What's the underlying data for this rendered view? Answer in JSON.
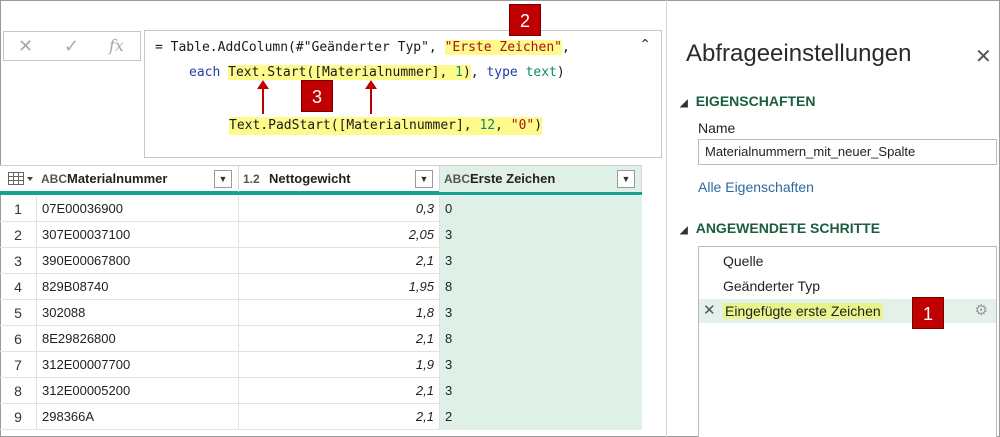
{
  "formula_bar": {
    "cancel_icon": "x-icon",
    "commit_icon": "check-icon",
    "fx_label": "fx",
    "line1_pre": "= Table.AddColumn(#\"Geänderter Typ\", ",
    "line1_hl": "\"Erste Zeichen\"",
    "line1_post": ",",
    "line2_kw": "each",
    "line2_func": "Text.Start([Materialnummer], ",
    "line2_num": "1",
    "line2_close": ")",
    "line2_rest": ", ",
    "line2_type": "type",
    "line2_text": "text",
    "line2_end": ")",
    "line3_pre": "Text.PadStart([Materialnummer], ",
    "line3_num": "12",
    "line3_mid": ", ",
    "line3_str": "\"0\"",
    "line3_end": ")",
    "collapse_icon": "chevron-up-icon"
  },
  "badges": {
    "b1": "1",
    "b2": "2",
    "b3": "3"
  },
  "accent_colors": {
    "badge": "#c00000",
    "header_underline": "#13a38f",
    "selected_column": "#dff0e7",
    "highlight": "#fffa8c"
  },
  "table": {
    "columns": [
      {
        "type": "ABC",
        "label": "Materialnummer"
      },
      {
        "type": "1.2",
        "label": "Nettogewicht"
      },
      {
        "type": "ABC",
        "label": "Erste Zeichen"
      }
    ],
    "rows": [
      {
        "idx": "1",
        "mat": "07E00036900",
        "net": "0,3",
        "ez": "0"
      },
      {
        "idx": "2",
        "mat": "307E00037100",
        "net": "2,05",
        "ez": "3"
      },
      {
        "idx": "3",
        "mat": "390E00067800",
        "net": "2,1",
        "ez": "3"
      },
      {
        "idx": "4",
        "mat": "829B08740",
        "net": "1,95",
        "ez": "8"
      },
      {
        "idx": "5",
        "mat": "302088",
        "net": "1,8",
        "ez": "3"
      },
      {
        "idx": "6",
        "mat": "8E29826800",
        "net": "2,1",
        "ez": "8"
      },
      {
        "idx": "7",
        "mat": "312E00007700",
        "net": "1,9",
        "ez": "3"
      },
      {
        "idx": "8",
        "mat": "312E00005200",
        "net": "2,1",
        "ez": "3"
      },
      {
        "idx": "9",
        "mat": "298366A",
        "net": "2,1",
        "ez": "2"
      }
    ]
  },
  "pane": {
    "title": "Abfrageeinstellungen",
    "close_icon": "close-icon",
    "properties_heading": "EIGENSCHAFTEN",
    "name_label": "Name",
    "name_value": "Materialnummern_mit_neuer_Spalte",
    "all_properties_link": "Alle Eigenschaften",
    "steps_heading": "ANGEWENDETE SCHRITTE",
    "steps": [
      "Quelle",
      "Geänderter Typ",
      "Eingefügte erste Zeichen"
    ]
  }
}
